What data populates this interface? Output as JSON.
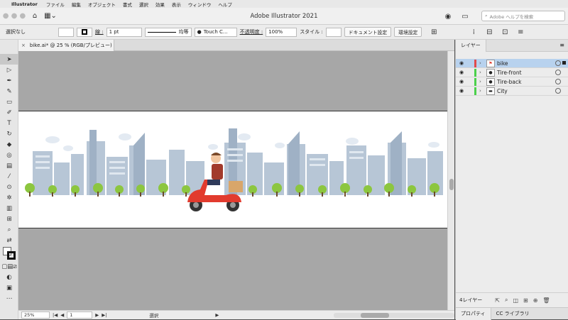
{
  "menubar": {
    "apple_icon": "",
    "app_name": "Illustrator",
    "items": [
      "ファイル",
      "編集",
      "オブジェクト",
      "書式",
      "選択",
      "効果",
      "表示",
      "ウィンドウ",
      "ヘルプ"
    ]
  },
  "appbar": {
    "title": "Adobe Illustrator 2021",
    "search_placeholder": "Adobe ヘルプを検索"
  },
  "control": {
    "selection": "選択なし",
    "stroke_label": "線 :",
    "stroke_weight": "1 pt",
    "stroke_profile": "均等",
    "brush": "Touch C...",
    "opacity_label": "不透明度 :",
    "opacity_value": "100%",
    "style_label": "スタイル :",
    "doc_setup_button": "ドキュメント設定",
    "prefs_button": "環境設定"
  },
  "document_tab": {
    "close_icon": "×",
    "title": "bike.ai* @ 25 % (RGB/プレビュー)"
  },
  "status": {
    "zoom": "25%",
    "page": "1",
    "mode": "選択"
  },
  "panel": {
    "tab_layers": "レイヤー",
    "menu_icon": "≡",
    "layers": [
      {
        "name": "bike",
        "color": "#e04b4b",
        "selected": true
      },
      {
        "name": "Tire-front",
        "color": "#4bd04b",
        "selected": false
      },
      {
        "name": "Tire-back",
        "color": "#4bd04b",
        "selected": false
      },
      {
        "name": "City",
        "color": "#4bd04b",
        "selected": false
      }
    ],
    "layer_count": "4レイヤー",
    "bottom_tab_properties": "プロパティ",
    "bottom_tab_cc": "CC ライブラリ"
  },
  "colors": {
    "building": "#b7c6d6",
    "building_dark": "#9fb1c5",
    "tree": "#8cc63f",
    "scooter": "#e23b2e",
    "selection_blue": "#b8d2ee"
  }
}
